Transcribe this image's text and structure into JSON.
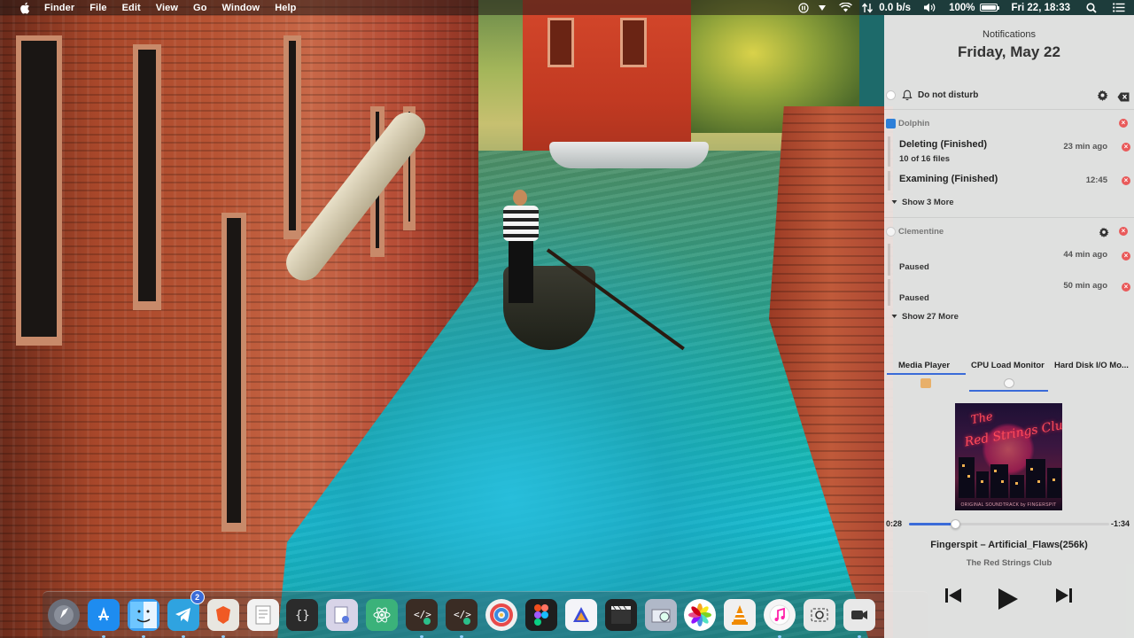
{
  "menubar": {
    "app_name": "Finder",
    "menus": [
      "File",
      "Edit",
      "View",
      "Go",
      "Window",
      "Help"
    ],
    "network_speed": "0.0 b/s",
    "battery_percent": "100%",
    "datetime": "Fri 22, 18:33"
  },
  "notifications": {
    "title": "Notifications",
    "date": "Friday, May 22",
    "do_not_disturb_label": "Do not disturb",
    "groups": [
      {
        "app": "Dolphin",
        "items": [
          {
            "title": "Deleting (Finished)",
            "body": "10 of 16 files",
            "time": "23 min ago"
          },
          {
            "title": "Examining (Finished)",
            "body": "",
            "time": "12:45"
          }
        ],
        "show_more": "Show 3 More"
      },
      {
        "app": "Clementine",
        "items": [
          {
            "title": "",
            "body": "Paused",
            "time": "44 min ago"
          },
          {
            "title": "",
            "body": "Paused",
            "time": "50 min ago"
          }
        ],
        "show_more": "Show 27 More"
      }
    ]
  },
  "widgets": {
    "tabs": [
      {
        "label": "Media Player",
        "active": true
      },
      {
        "label": "CPU Load Monitor",
        "active": false
      },
      {
        "label": "Hard Disk I/O Mo...",
        "active": false
      }
    ]
  },
  "media_player": {
    "album_art_text": [
      "The",
      "Red Strings Club"
    ],
    "album_art_caption": "ORIGINAL SOUNDTRACK by FINGERSPIT",
    "time_elapsed": "0:28",
    "time_remaining": "-1:34",
    "progress_fraction": 0.23,
    "track_title": "Fingerspit – Artificial_Flaws(256k)",
    "artist": "The Red Strings Club",
    "controls": [
      "previous",
      "play",
      "next"
    ]
  },
  "dock": {
    "items": [
      {
        "name": "launchpad",
        "color": "#6b6f7a",
        "running": false
      },
      {
        "name": "app-store",
        "color": "#1e8cf0",
        "running": true
      },
      {
        "name": "finder",
        "color": "#3ca0f0",
        "running": true
      },
      {
        "name": "telegram",
        "color": "#2fa3e0",
        "running": true,
        "badge": "2"
      },
      {
        "name": "brave-browser",
        "color": "#e8e6e0",
        "running": true
      },
      {
        "name": "textedit",
        "color": "#f2f2f2",
        "running": false
      },
      {
        "name": "script-editor",
        "color": "#2b2b2b",
        "running": false
      },
      {
        "name": "preview-files",
        "color": "#d8d4e8",
        "running": false
      },
      {
        "name": "atom-editor",
        "color": "#3bb27a",
        "running": false
      },
      {
        "name": "code-runner-1",
        "color": "#3a2c24",
        "running": true
      },
      {
        "name": "code-runner-2",
        "color": "#3a2c24",
        "running": true
      },
      {
        "name": "color-picker",
        "color": "#f0f0f0",
        "running": false
      },
      {
        "name": "figma",
        "color": "#1e1e1e",
        "running": false
      },
      {
        "name": "affinity-designer",
        "color": "#f4f4f8",
        "running": false
      },
      {
        "name": "final-cut",
        "color": "#222",
        "running": false
      },
      {
        "name": "image-capture",
        "color": "#b0b8c8",
        "running": false
      },
      {
        "name": "photos",
        "color": "#ffffff",
        "running": false
      },
      {
        "name": "vlc",
        "color": "#f0f0f0",
        "running": false
      },
      {
        "name": "music",
        "color": "#f5f5f5",
        "running": true
      },
      {
        "name": "screenshot",
        "color": "#e8e8e8",
        "running": false
      },
      {
        "name": "photo-booth",
        "color": "#e8e8e8",
        "running": true
      }
    ]
  },
  "colors": {
    "accent": "#3a6bd8",
    "close_red": "#e95a5a"
  }
}
